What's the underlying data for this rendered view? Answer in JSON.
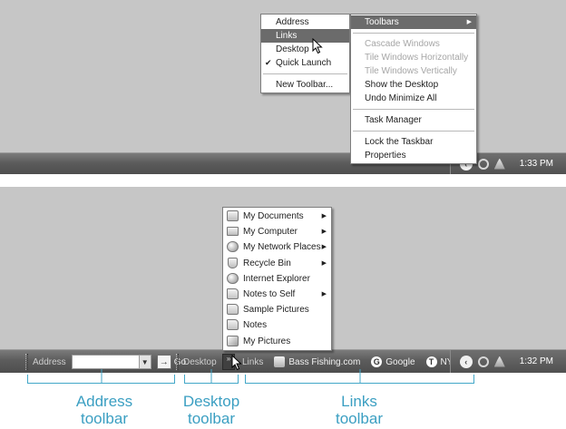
{
  "top": {
    "toolbars_submenu": [
      {
        "label": "Address",
        "selected": false,
        "checked": false
      },
      {
        "label": "Links",
        "selected": true,
        "checked": false
      },
      {
        "label": "Desktop",
        "selected": false,
        "checked": false
      },
      {
        "label": "Quick Launch",
        "selected": false,
        "checked": true
      },
      {
        "label": "New Toolbar...",
        "selected": false,
        "checked": false
      }
    ],
    "taskbar_menu": {
      "toolbars": "Toolbars",
      "cascade": "Cascade Windows",
      "tile_h": "Tile Windows Horizontally",
      "tile_v": "Tile Windows Vertically",
      "show_desktop": "Show the Desktop",
      "undo_minimize": "Undo Minimize All",
      "task_manager": "Task Manager",
      "lock": "Lock the Taskbar",
      "properties": "Properties"
    },
    "clock": "1:33 PM"
  },
  "bottom": {
    "links_menu": [
      {
        "label": "My Documents",
        "icon": "documents-icon",
        "submenu": true
      },
      {
        "label": "My Computer",
        "icon": "computer-icon",
        "submenu": true
      },
      {
        "label": "My Network Places",
        "icon": "network-icon",
        "submenu": true
      },
      {
        "label": "Recycle Bin",
        "icon": "recycle-bin-icon",
        "submenu": true
      },
      {
        "label": "Internet Explorer",
        "icon": "globe-icon",
        "submenu": false
      },
      {
        "label": "Notes to Self",
        "icon": "folder-icon",
        "submenu": true
      },
      {
        "label": "Sample Pictures",
        "icon": "folder-icon",
        "submenu": false
      },
      {
        "label": "Notes",
        "icon": "folder-icon",
        "submenu": false
      },
      {
        "label": "My Pictures",
        "icon": "pictures-icon",
        "submenu": false
      }
    ],
    "address_label": "Address",
    "go_label": "Go",
    "desktop_label": "Desktop",
    "links_label": "Links",
    "links": {
      "bass": "Bass Fishing.com",
      "google": "Google",
      "nytimes": "NY Times"
    },
    "clock": "1:32 PM"
  },
  "callouts": {
    "address_line1": "Address",
    "address_line2": "toolbar",
    "desktop_line1": "Desktop",
    "desktop_line2": "toolbar",
    "links_line1": "Links",
    "links_line2": "toolbar"
  },
  "colors": {
    "desktop": "#c6c6c6",
    "taskbar": "#5c5c5c",
    "selection": "#6b6b6b",
    "callout": "#3b9fc2"
  }
}
